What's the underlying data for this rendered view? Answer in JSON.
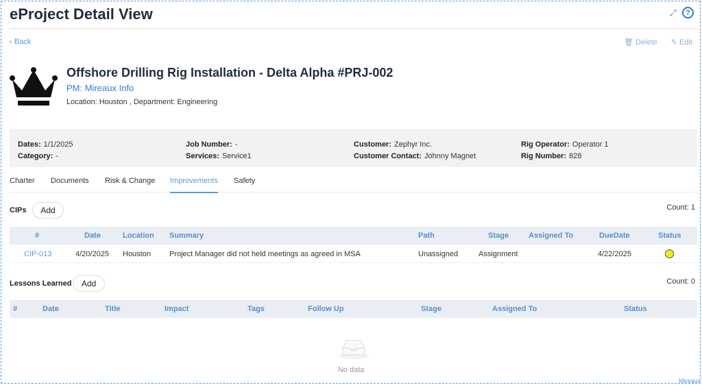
{
  "app": {
    "title": "eProject Detail View",
    "footer": "Mireaux"
  },
  "nav": {
    "back": "Back",
    "delete": "Delete",
    "edit": "Edit"
  },
  "project": {
    "title": "Offshore Drilling Rig Installation - Delta Alpha #PRJ-002",
    "pm": "PM: Mireaux Info",
    "location": "Location: Houston , Department: Engineering"
  },
  "info": {
    "dates_label": "Dates:",
    "dates_value": "1/1/2025",
    "category_label": "Category:",
    "category_value": "-",
    "job_label": "Job Number:",
    "job_value": "-",
    "services_label": "Services:",
    "services_value": "Service1",
    "customer_label": "Customer:",
    "customer_value": "Zephyr Inc.",
    "contact_label": "Customer Contact:",
    "contact_value": "Johnny Magnet",
    "rig_op_label": "Rig Operator:",
    "rig_op_value": "Operator 1",
    "rig_num_label": "Rig Number:",
    "rig_num_value": "828"
  },
  "tabs": [
    "Charter",
    "Documents",
    "Risk & Change",
    "Improvements",
    "Safety"
  ],
  "cips": {
    "label": "CIPs",
    "add": "Add",
    "count": "Count: 1",
    "headers": [
      "#",
      "Date",
      "Location",
      "Summary",
      "Path",
      "Stage",
      "Assigned To",
      "DueDate",
      "Status"
    ],
    "rows": [
      {
        "id": "CIP-013",
        "date": "4/20/2025",
        "location": "Houston",
        "summary": "Project Manager did not held meetings as agreed in MSA",
        "path": "Unassigned",
        "stage": "Assignment",
        "assigned": "",
        "due": "4/22/2025",
        "status_color": "#f5ea14"
      }
    ]
  },
  "lessons": {
    "label": "Lessons Learned",
    "add": "Add",
    "count": "Count: 0",
    "headers": [
      "#",
      "Date",
      "Title",
      "Impact",
      "Tags",
      "Follow Up",
      "Stage",
      "Assigned To",
      "Status"
    ],
    "empty": "No data"
  }
}
